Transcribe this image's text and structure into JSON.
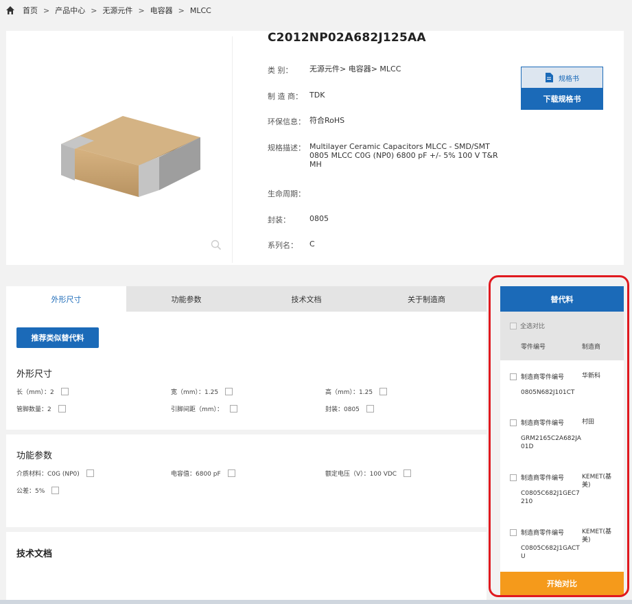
{
  "breadcrumb": [
    "首页",
    "产品中心",
    "无源元件",
    "电容器",
    "MLCC"
  ],
  "breadcrumb_sep": ">",
  "product": {
    "title": "C2012NP02A682J125AA",
    "rows": [
      {
        "label": "类 别：",
        "value": "无源元件> 电容器> MLCC"
      },
      {
        "label": "制 造 商：",
        "value": "TDK"
      },
      {
        "label": "环保信息：",
        "value": "符合RoHS"
      },
      {
        "label": "规格描述：",
        "value": "Multilayer Ceramic Capacitors MLCC - SMD/SMT 0805 MLCC C0G (NP0) 6800 pF +/- 5% 100 V T&R MH"
      },
      {
        "label": "生命周期：",
        "value": ""
      },
      {
        "label": "封装：",
        "value": "0805"
      },
      {
        "label": "系列名：",
        "value": "C"
      }
    ]
  },
  "spec": {
    "top_label": "规格书",
    "download_label": "下载规格书"
  },
  "tabs": [
    "外形尺寸",
    "功能参数",
    "技术文档",
    "关于制造商"
  ],
  "recommend_button": "推荐类似替代料",
  "dimensions": {
    "title": "外形尺寸",
    "params": [
      "长（mm）：2",
      "宽（mm）：1.25",
      "高（mm）：1.25",
      "管脚数量：2",
      "引脚间距（mm）：",
      "封装：0805"
    ]
  },
  "function": {
    "title": "功能参数",
    "params": [
      "介质材料：C0G (NP0)",
      "电容值：6800 pF",
      "额定电压（V）：100 VDC",
      "公差：5%"
    ]
  },
  "docs": {
    "title": "技术文档"
  },
  "alternatives": {
    "header": "替代料",
    "select_all": "全选对比",
    "col_part": "零件编号",
    "col_mfr": "制造商",
    "items": [
      {
        "label": "制造商零件编号",
        "mfr": "华新科",
        "part": "0805N682J101CT"
      },
      {
        "label": "制造商零件编号",
        "mfr": "村田",
        "part": "GRM2165C2A682JA01D"
      },
      {
        "label": "制造商零件编号",
        "mfr": "KEMET(基美)",
        "part": "C0805C682J1GEC7210"
      },
      {
        "label": "制造商零件编号",
        "mfr": "KEMET(基美)",
        "part": "C0805C682J1GACTU"
      }
    ],
    "compare_button": "开始对比"
  },
  "colors": {
    "accent": "#1b6ab8",
    "orange": "#f59a1b",
    "highlight": "#e0191f"
  }
}
